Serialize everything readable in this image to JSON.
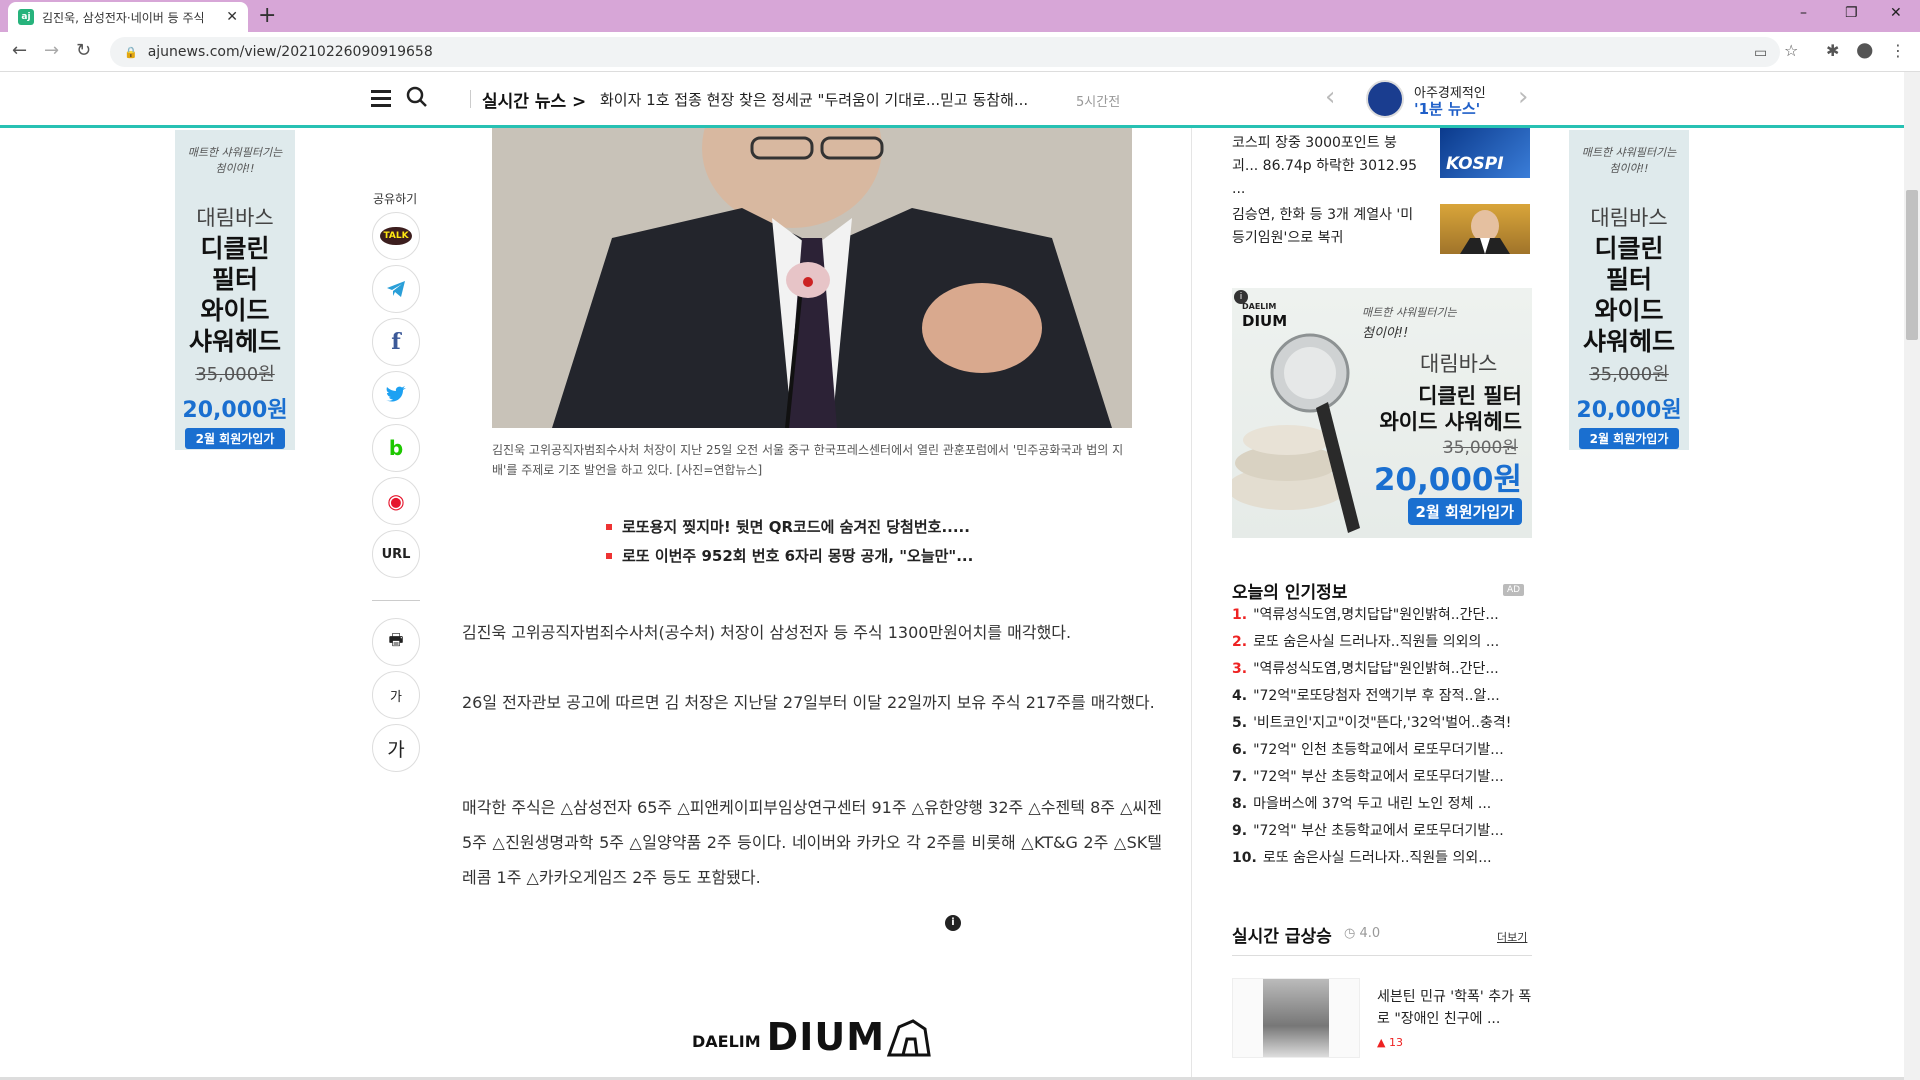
{
  "browser": {
    "tab_title": "김진욱, 삼성전자·네이버 등 주식",
    "favicon_text": "aj",
    "new_tab": "+",
    "url": "ajunews.com/view/20210226090919658",
    "window_controls": [
      "–",
      "❐",
      "✕"
    ]
  },
  "header": {
    "live_label": "실시간 뉴스 >",
    "live_headline": "화이자 1호 접종 현장 찾은 정세균 \"두려움이 기대로...믿고 동참해...",
    "live_time": "5시간전",
    "one_minute_top": "아주경제적인",
    "one_minute_bottom": "'1분 뉴스'",
    "accent_color": "#27c1b3"
  },
  "side_ad": {
    "line1": "매트한 샤워필터기는",
    "line1b": "첨이야!!",
    "brand": "대림바스",
    "product_lines": [
      "디클린",
      "필터",
      "와이드",
      "샤워헤드"
    ],
    "old_price": "35,000원",
    "new_price": "20,000원",
    "badge": "2월 회원가입가"
  },
  "share": {
    "title": "공유하기",
    "kakao": "TALK",
    "url": "URL",
    "font_small": "가",
    "font_large": "가"
  },
  "article": {
    "caption": "김진욱 고위공직자범죄수사처 처장이 지난 25일 오전 서울 중구 한국프레스센터에서 열린 관훈포럼에서 '민주공화국과 법의 지배'를 주제로 기조 발언을 하고 있다. [사진=연합뉴스]",
    "related": [
      "로또용지 찢지마! 뒷면 QR코드에 숨겨진 당첨번호.....",
      "로또 이번주 952회 번호 6자리 몽땅 공개, \"오늘만\"..."
    ],
    "paragraphs": [
      "김진욱 고위공직자범죄수사처(공수처) 처장이 삼성전자 등 주식 1300만원어치를 매각했다.",
      "26일 전자관보 공고에 따르면 김 처장은 지난달 27일부터 이달 22일까지 보유 주식 217주를 매각했다.",
      "매각한 주식은 △삼성전자 65주 △피앤케이피부임상연구센터 91주 △유한양행 32주 △수젠텍 8주 △씨젠 5주 △진원생명과학 5주 △일양약품 2주 등이다. 네이버와 카카오 각 2주를 비롯해 △KT&G 2주 △SK텔레콤 1주 △카카오게임즈 2주 등도 포함됐다."
    ],
    "ad_info": "i",
    "bottom_ad_brand_small": "DAELIM",
    "bottom_ad_brand_large": "DIUM"
  },
  "sidebar": {
    "top_news": [
      {
        "text": "코스피 장중 3000포인트 붕괴... 86.74p 하락한 3012.95 ...",
        "thumb": "KOSPI"
      },
      {
        "text": "김승연, 한화 등 3개 계열사 '미등기임원'으로 복귀",
        "thumb": ""
      }
    ],
    "big_ad": {
      "brand_small": "DAELIM",
      "brand_large": "DIUM",
      "line1": "매트한 샤워필터기는",
      "line1b": "첨이야!!",
      "brand": "대림바스",
      "product1": "디클린 필터",
      "product2": "와이드 샤워헤드",
      "old_price": "35,000원",
      "new_price": "20,000원",
      "badge": "2월 회원가입가"
    },
    "popular_title": "오늘의 인기정보",
    "popular_ad": "AD",
    "popular": [
      {
        "num": "1.",
        "text": "\"역류성식도염,명치답답\"원인밝혀..간단..."
      },
      {
        "num": "2.",
        "text": "로또 숨은사실 드러나자..직원들 의외의 ..."
      },
      {
        "num": "3.",
        "text": "\"역류성식도염,명치답답\"원인밝혀..간단..."
      },
      {
        "num": "4.",
        "text": "\"72억\"로또당첨자 전액기부 후 잠적..알..."
      },
      {
        "num": "5.",
        "text": "'비트코인'지고\"이것\"뜬다,'32억'벌어..충격!"
      },
      {
        "num": "6.",
        "text": "\"72억\" 인천 초등학교에서 로또무더기발..."
      },
      {
        "num": "7.",
        "text": "\"72억\" 부산 초등학교에서 로또무더기발..."
      },
      {
        "num": "8.",
        "text": "마을버스에 37억 두고 내린 노인 정체 ..."
      },
      {
        "num": "9.",
        "text": "\"72억\" 부산 초등학교에서 로또무더기발..."
      },
      {
        "num": "10.",
        "text": "로또 숨은사실 드러나자..직원들 의외..."
      }
    ],
    "realtime_title": "실시간 급상승",
    "realtime_time": "4.0",
    "realtime_more": "더보기",
    "realtime_item": "세븐틴 민규 '학폭' 추가 폭로 \"장애인 친구에 ...",
    "realtime_count": "13"
  }
}
